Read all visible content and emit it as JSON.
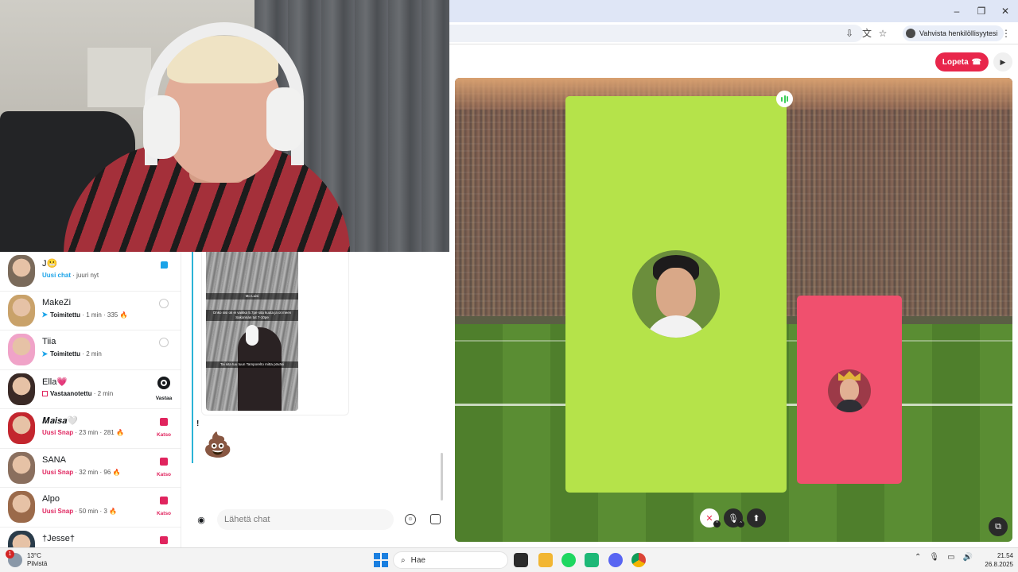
{
  "browser": {
    "verify_chip_label": "Vahvista henkilöllisyytesi"
  },
  "call": {
    "end_button_label": "Lopeta",
    "end_icon": "phone-hangup-icon",
    "colors": {
      "main_tile": "#b5e34a",
      "self_tile": "#f0506e",
      "end_button": "#e8264b"
    }
  },
  "chat_list": {
    "items": [
      {
        "name": "J😬",
        "status_accent": "Uusi chat",
        "status_rest": "· juuri nyt",
        "accent_color": "#1ba3e8",
        "action_label": "",
        "action_icon": "chat-bubble-icon"
      },
      {
        "name": "MakeZi",
        "status_accent": "Toimitettu",
        "status_rest": "· 1 min · 335 🔥",
        "accent_color": "#16191c",
        "action_label": "",
        "action_icon": "camera-reply-icon"
      },
      {
        "name": "Tiia",
        "status_accent": "Toimitettu",
        "status_rest": "· 2 min",
        "accent_color": "#16191c",
        "action_label": "",
        "action_icon": "camera-reply-icon"
      },
      {
        "name": "Ella💗",
        "status_accent": "Vastaanotettu",
        "status_rest": "· 2 min",
        "accent_color": "#16191c",
        "action_label": "Vastaa",
        "action_icon": "camera-icon"
      },
      {
        "name": "𝑴𝒂𝒊𝒔𝒂🤍",
        "status_accent": "Uusi Snap",
        "status_rest": "· 23 min · 281 🔥",
        "accent_color": "#e0245e",
        "action_label": "Katso",
        "action_icon": "snap-square-icon"
      },
      {
        "name": "SANA",
        "status_accent": "Uusi Snap",
        "status_rest": "· 32 min · 96 🔥",
        "accent_color": "#e0245e",
        "action_label": "Katso",
        "action_icon": "snap-square-icon"
      },
      {
        "name": "Alpo",
        "status_accent": "Uusi Snap",
        "status_rest": "· 50 min · 3 🔥",
        "accent_color": "#e0245e",
        "action_label": "Katso",
        "action_icon": "snap-square-icon"
      },
      {
        "name": "†Jesse†",
        "status_accent": "",
        "status_rest": "",
        "accent_color": "#e0245e",
        "action_label": "",
        "action_icon": "snap-square-icon"
      }
    ]
  },
  "conversation": {
    "snap_caption_1": "Mo Luisi",
    "snap_caption_2": "Onko sisi ok ei vaikka 5.7pe sita kuuta ja ot meen Sakonnan tut 7-10pe",
    "snap_caption_3": "Tai sita tuu tuun Tamporelto mitta pöväsi",
    "exclamation": "!",
    "emoji": "💩",
    "input_placeholder": "Lähetä chat"
  },
  "taskbar": {
    "weather_temp": "13°C",
    "weather_desc": "Pilvistä",
    "weather_badge": "1",
    "search_label": "Hae",
    "time": "21.54",
    "date": "26.8.2025"
  }
}
